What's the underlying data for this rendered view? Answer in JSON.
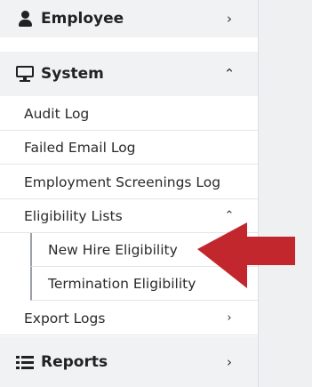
{
  "sidebar": {
    "employee": {
      "label": "Employee",
      "icon": "user-icon",
      "chevron": "›"
    },
    "system": {
      "label": "System",
      "icon": "monitor-icon",
      "chevron": "⌃"
    },
    "system_items": [
      {
        "label": "Audit Log"
      },
      {
        "label": "Failed Email Log"
      },
      {
        "label": "Employment Screenings Log"
      },
      {
        "label": "Eligibility Lists",
        "chevron": "⌃"
      },
      {
        "label": "Export Logs",
        "chevron": "›"
      }
    ],
    "eligibility_subitems": [
      {
        "label": "New Hire Eligibility"
      },
      {
        "label": "Termination Eligibility"
      }
    ],
    "reports": {
      "label": "Reports",
      "icon": "list-icon",
      "chevron": "›"
    }
  },
  "annotation": {
    "icon": "red-arrow-icon",
    "color": "#c1272d"
  }
}
